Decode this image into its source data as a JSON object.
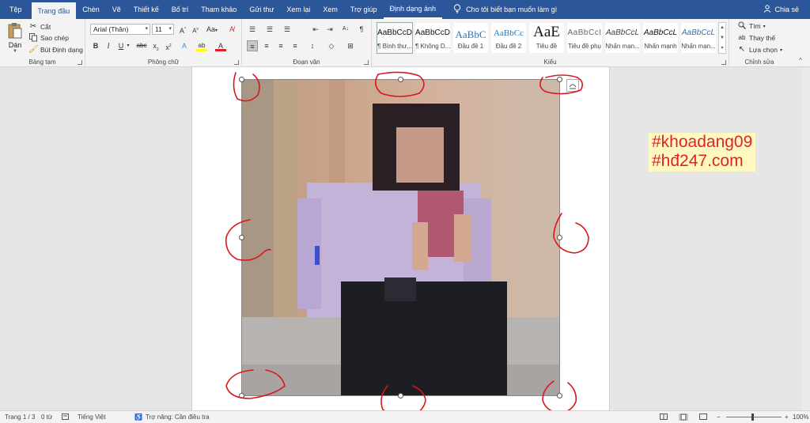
{
  "tabs": [
    "Tệp",
    "Trang đầu",
    "Chèn",
    "Vẽ",
    "Thiết kế",
    "Bố trí",
    "Tham khảo",
    "Gửi thư",
    "Xem lại",
    "Xem",
    "Trợ giúp",
    "Định dạng ảnh"
  ],
  "active_tab": "Trang đầu",
  "tell_me": "Cho tôi biết bạn muốn làm gì",
  "share": "Chia sẻ",
  "clipboard": {
    "paste": "Dán",
    "cut": "Cắt",
    "copy": "Sao chép",
    "format_painter": "Bút Định dạng",
    "label": "Bảng tạm"
  },
  "font": {
    "name": "Arial (Thân)",
    "size": "11",
    "label": "Phông chữ",
    "case_button": "Aa"
  },
  "paragraph": {
    "label": "Đoạn văn"
  },
  "styles": {
    "label": "Kiểu",
    "items": [
      {
        "sample": "AaBbCcD",
        "name": "¶ Bình thư...",
        "selected": true
      },
      {
        "sample": "AaBbCcD",
        "name": "¶ Không D..."
      },
      {
        "sample": "AaBbC",
        "name": "Đầu đề 1"
      },
      {
        "sample": "AaBbCc",
        "name": "Đầu đề 2"
      },
      {
        "sample": "AaE",
        "name": "Tiêu đề"
      },
      {
        "sample": "AaBbCcI",
        "name": "Tiêu đề phụ"
      },
      {
        "sample": "AaBbCcL",
        "name": "Nhấn mạn..."
      },
      {
        "sample": "AaBbCcL",
        "name": "Nhấn mạnh"
      },
      {
        "sample": "AaBbCcL",
        "name": "Nhấn mạn..."
      }
    ]
  },
  "editing": {
    "label": "Chỉnh sửa",
    "find": "Tìm",
    "replace": "Thay thế",
    "select": "Lựa chọn"
  },
  "watermark": {
    "line1": "#khoadang09",
    "line2": "#hđ247.com"
  },
  "status": {
    "page": "Trang 1 / 3",
    "words": "0 từ",
    "language": "Tiếng Việt",
    "accessibility": "Trợ năng: Cần điều tra",
    "zoom": "100%"
  },
  "colors": {
    "ribbon_blue": "#2b579a",
    "annotation_red": "#d8171e",
    "watermark_text": "#e0232a",
    "watermark_bg": "#fff9c0"
  }
}
